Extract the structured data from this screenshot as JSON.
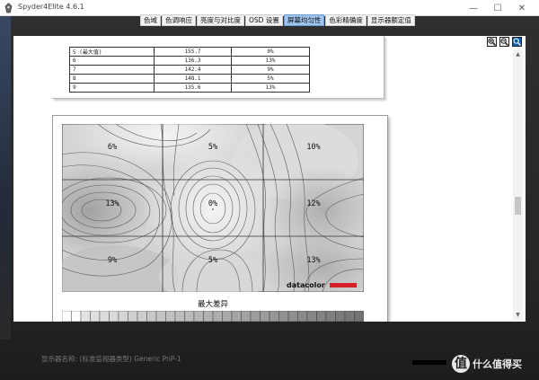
{
  "window": {
    "title": "Spyder4Elite 4.6.1",
    "minimize_symbol": "—",
    "maximize_symbol": "☐",
    "close_symbol": "✕",
    "icon": "app-icon"
  },
  "tabs": [
    {
      "label": "色域",
      "active": false
    },
    {
      "label": "色调响应",
      "active": false
    },
    {
      "label": "亮度与对比度",
      "active": false
    },
    {
      "label": "OSD 设置",
      "active": false
    },
    {
      "label": "屏幕均匀性",
      "active": true
    },
    {
      "label": "色彩精确度",
      "active": false
    },
    {
      "label": "显示器额定值",
      "active": false
    }
  ],
  "zoom_tools": [
    {
      "icon": "zoom-in-icon",
      "active": false
    },
    {
      "icon": "zoom-out-icon",
      "active": false
    },
    {
      "icon": "zoom-fit-icon",
      "active": true
    }
  ],
  "table_rows": [
    [
      "5 (最大值)",
      "155.7",
      "0%"
    ],
    [
      "6",
      "136.3",
      "13%"
    ],
    [
      "7",
      "142.4",
      "9%"
    ],
    [
      "8",
      "148.1",
      "5%"
    ],
    [
      "9",
      "135.6",
      "13%"
    ]
  ],
  "chart_data": {
    "type": "heatmap",
    "title": "",
    "caption": "最大差异",
    "rows": 3,
    "cols": 3,
    "cells": [
      [
        "6%",
        "5%",
        "10%"
      ],
      [
        "13%",
        "0%",
        "12%"
      ],
      [
        "9%",
        "5%",
        "13%"
      ]
    ],
    "values": [
      [
        6,
        5,
        10
      ],
      [
        13,
        0,
        12
      ],
      [
        9,
        5,
        13
      ]
    ],
    "brand": "datacolor",
    "brand_color": "#d5202a",
    "colors": {
      "light": "#ebebeb",
      "dark": "#9c9c9c",
      "contour": "#555555"
    }
  },
  "footer": {
    "monitor_label": "显示器名称: (标准监视器类型) Generic PnP-1",
    "watermark_logo": "值",
    "watermark_text": "什么值得买"
  }
}
